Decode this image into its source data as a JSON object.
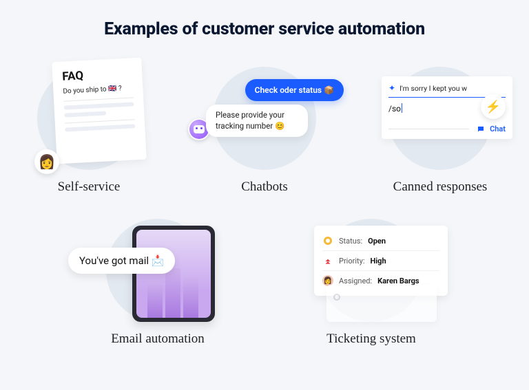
{
  "title": "Examples of customer service automation",
  "items": {
    "self_service": {
      "caption": "Self-service",
      "faq_label": "FAQ",
      "question": "Do you ship to  🇬🇧  ?",
      "avatar_emoji": "👩"
    },
    "chatbots": {
      "caption": "Chatbots",
      "user_msg": "Check oder status 📦",
      "bot_msg": "Please provide your tracking number 😊"
    },
    "canned": {
      "caption": "Canned responses",
      "preview": "I'm sorry I kept you w",
      "command": "/so",
      "channel_label": "Chat",
      "bolt_emoji": "⚡"
    },
    "email": {
      "caption": "Email automation",
      "bubble": "You've got mail 📩"
    },
    "ticketing": {
      "caption": "Ticketing system",
      "status_label": "Status:",
      "status_value": "Open",
      "priority_label": "Priority:",
      "priority_value": "High",
      "assigned_label": "Assigned:",
      "assigned_value": "Karen Bargs"
    }
  }
}
